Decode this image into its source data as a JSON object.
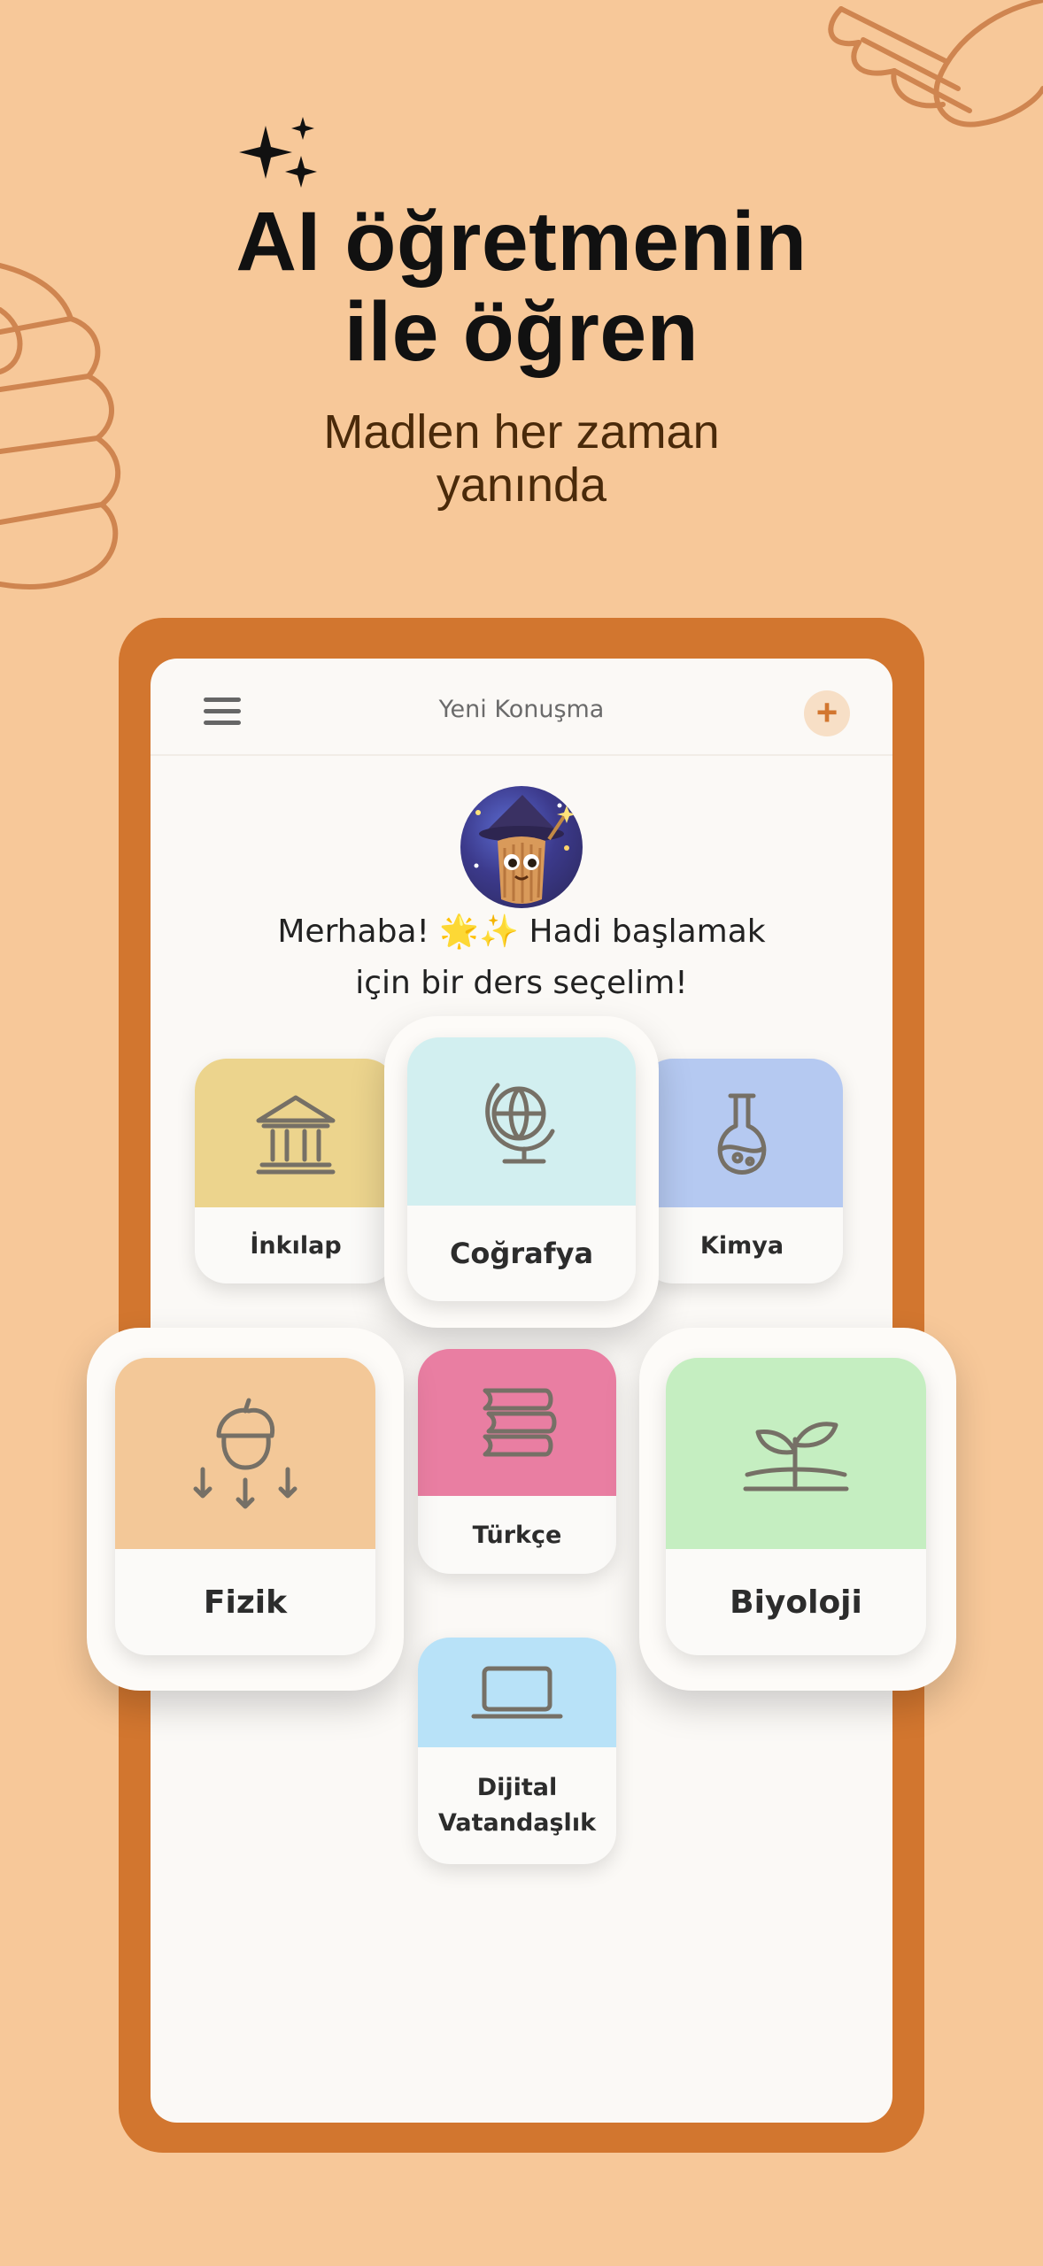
{
  "promo": {
    "headline_line1": "AI öğretmenin",
    "headline_line2": "ile öğren",
    "subline_line1": "Madlen her zaman",
    "subline_line2": "yanında"
  },
  "app": {
    "topbar": {
      "title": "Yeni Konuşma",
      "menu_icon": "hamburger-menu-icon",
      "new_chat_icon": "plus-icon",
      "new_chat_symbol": "+"
    },
    "greeting_line1": "Merhaba! 🌟✨ Hadi başlamak",
    "greeting_line2": "için bir ders seçelim!",
    "subjects": [
      {
        "label": "İnkılap",
        "icon": "temple-icon",
        "color": "#ecd48d"
      },
      {
        "label": "Coğrafya",
        "icon": "globe-icon",
        "color": "#d2eff0"
      },
      {
        "label": "Kimya",
        "icon": "flask-icon",
        "color": "#b5c9f1"
      },
      {
        "label": "Fizik",
        "icon": "falling-acorn-icon",
        "color": "#f3c898"
      },
      {
        "label": "Türkçe",
        "icon": "books-icon",
        "color": "#e97ea2"
      },
      {
        "label": "Biyoloji",
        "icon": "sprout-icon",
        "color": "#c5eec1"
      },
      {
        "label": "Dijital Vatandaşlık",
        "label_line1": "Dijital",
        "label_line2": "Vatandaşlık",
        "icon": "laptop-icon",
        "color": "#b8e2f8"
      }
    ]
  },
  "colors": {
    "background": "#f7c899",
    "phone_frame": "#d2762f",
    "screen": "#fbf9f6",
    "accent": "#d2762f"
  }
}
